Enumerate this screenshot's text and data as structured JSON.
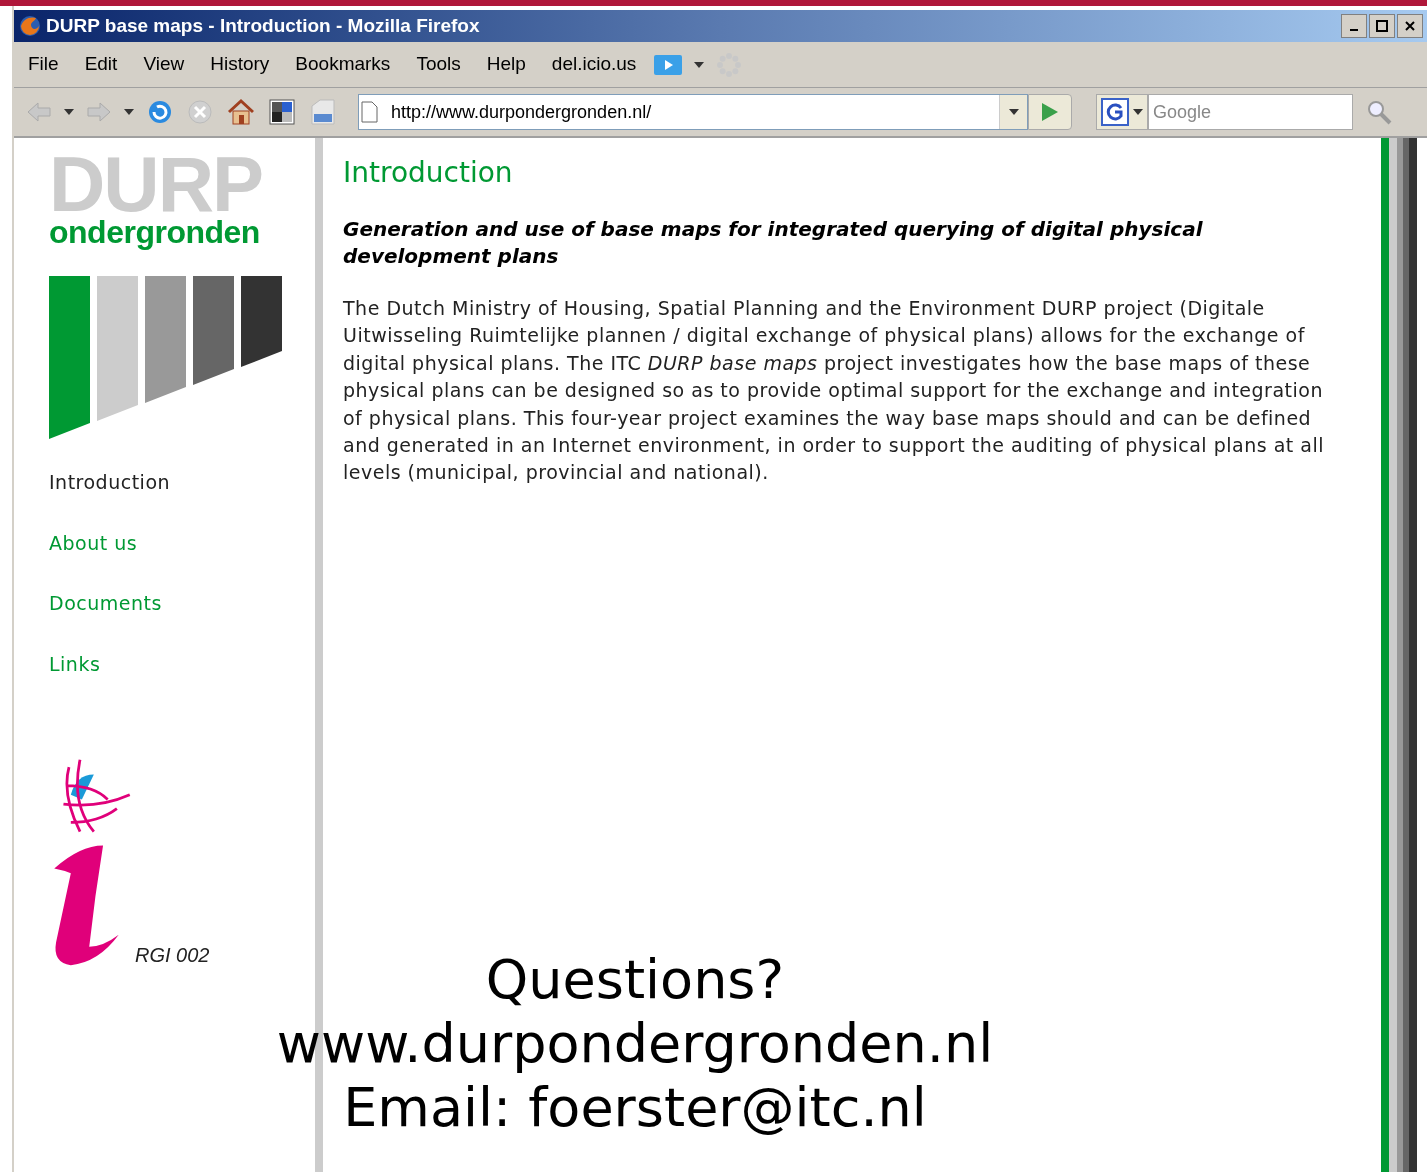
{
  "window": {
    "title": "DURP base maps - Introduction - Mozilla Firefox"
  },
  "menu": [
    "File",
    "Edit",
    "View",
    "History",
    "Bookmarks",
    "Tools",
    "Help",
    "del.icio.us"
  ],
  "address_bar": {
    "value": "http://www.durpondergronden.nl/"
  },
  "search": {
    "placeholder": "Google"
  },
  "logo": {
    "title": "DURP",
    "subtitle": "ondergronden"
  },
  "nav": [
    {
      "label": "Introduction",
      "selected": true
    },
    {
      "label": "About us",
      "selected": false
    },
    {
      "label": "Documents",
      "selected": false
    },
    {
      "label": "Links",
      "selected": false
    }
  ],
  "badge": {
    "caption": "RGI 002"
  },
  "article": {
    "heading": "Introduction",
    "subtitle": "Generation and use of base maps for integrated querying of digital physical development plans",
    "body": "The Dutch Ministry of Housing, Spatial Planning and the Environment DURP project (Digitale Uitwisseling Ruimtelijke plannen / digital exchange of physical plans) allows for the exchange of digital physical plans. The ITC *DURP base maps* project investigates how the base maps of these physical plans can be designed so as to provide optimal support for the exchange and integration of physical plans. This four-year project examines the way base maps should and can be defined and generated in an Internet environment, in order to support the auditing of physical plans at all levels (municipal, provincial and national)."
  },
  "overlay": [
    "Questions?",
    "www.durpondergronden.nl",
    "Email: foerster@itc.nl"
  ]
}
